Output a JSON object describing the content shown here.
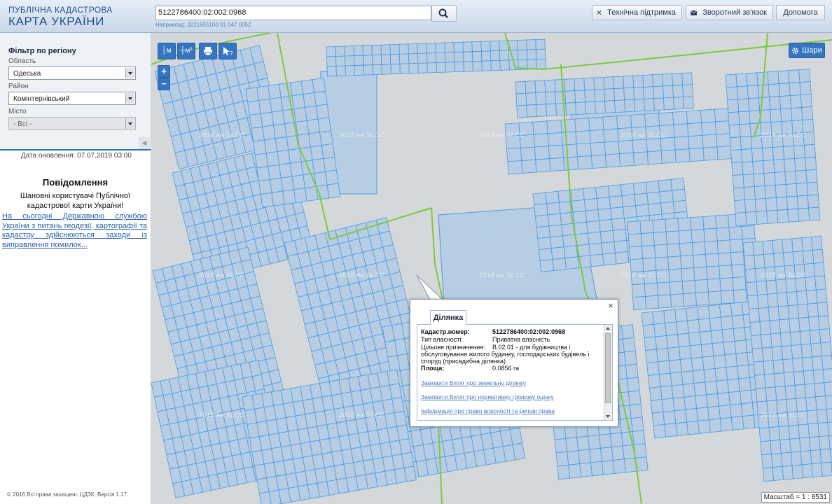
{
  "header": {
    "logo_line1": "ПУБЛІЧНА КАДАСТРОВА",
    "logo_line2": "КАРТА УКРАЇНИ",
    "search_value": "5122786400:02:002:0968",
    "search_hint": "Наприклад: 3221655100 01 047 0052",
    "support_label": "Технічна підтримка",
    "feedback_label": "Зворотний зв'язок",
    "help_label": "Допомога"
  },
  "sidebar": {
    "filter_title": "Фільтр по регіону",
    "oblast_label": "Область",
    "oblast_value": "Одеська",
    "raion_label": "Район",
    "raion_value": "Комінтернівський",
    "misto_label": "Місто",
    "misto_value": "- Всі -",
    "update_text": "Дата оновлення: 07.07.2019 03:00",
    "messages_title": "Повідомлення",
    "messages_body": "Шановні користувачі Публічної кадастрової карти України!",
    "messages_link": "На сьогодні Державною службою України з питань геодезії, картографії та кадастру здійснюються заходи із виправлення помилок...",
    "footer": "© 2016 Всі права захищені. ЦДЗК. Версія 1.17."
  },
  "map": {
    "tool_ruler": "│м",
    "tool_area": "┼м²",
    "layers_label": "Шари",
    "watermark": "2018 на SLCC",
    "scale_text": "Масштаб = 1 : 8531",
    "zoom_in": "+",
    "zoom_out": "−"
  },
  "popup": {
    "tab": "Ділянка",
    "cad_label": "Кадастр.номер:",
    "cad_value": "5122786400:02:002:0968",
    "own_label": "Тип власності:",
    "own_value": "Приватна власність",
    "purpose_label": "Цільове призначення:",
    "purpose_value": "В.02.01 - для будівництва і",
    "purpose_line2": "обслуговування жилого будинку, господарських будівель і",
    "purpose_line3": "споруд (присадибна ділянка)",
    "area_label": "Площа:",
    "area_value": "0.0856 га",
    "link1": "Замовити Витяг про земельну ділянку",
    "link2": "Замовити Витяг про нормативну грошову оцінку",
    "link3": "Інформація про право власності та речові права",
    "close": "×"
  },
  "colors": {
    "accent": "#3576c2",
    "parcel_fill": "#b6cde4",
    "parcel_stroke": "#4a9be0",
    "boundary": "#7dc93a",
    "map_bg": "#d5d8db"
  }
}
